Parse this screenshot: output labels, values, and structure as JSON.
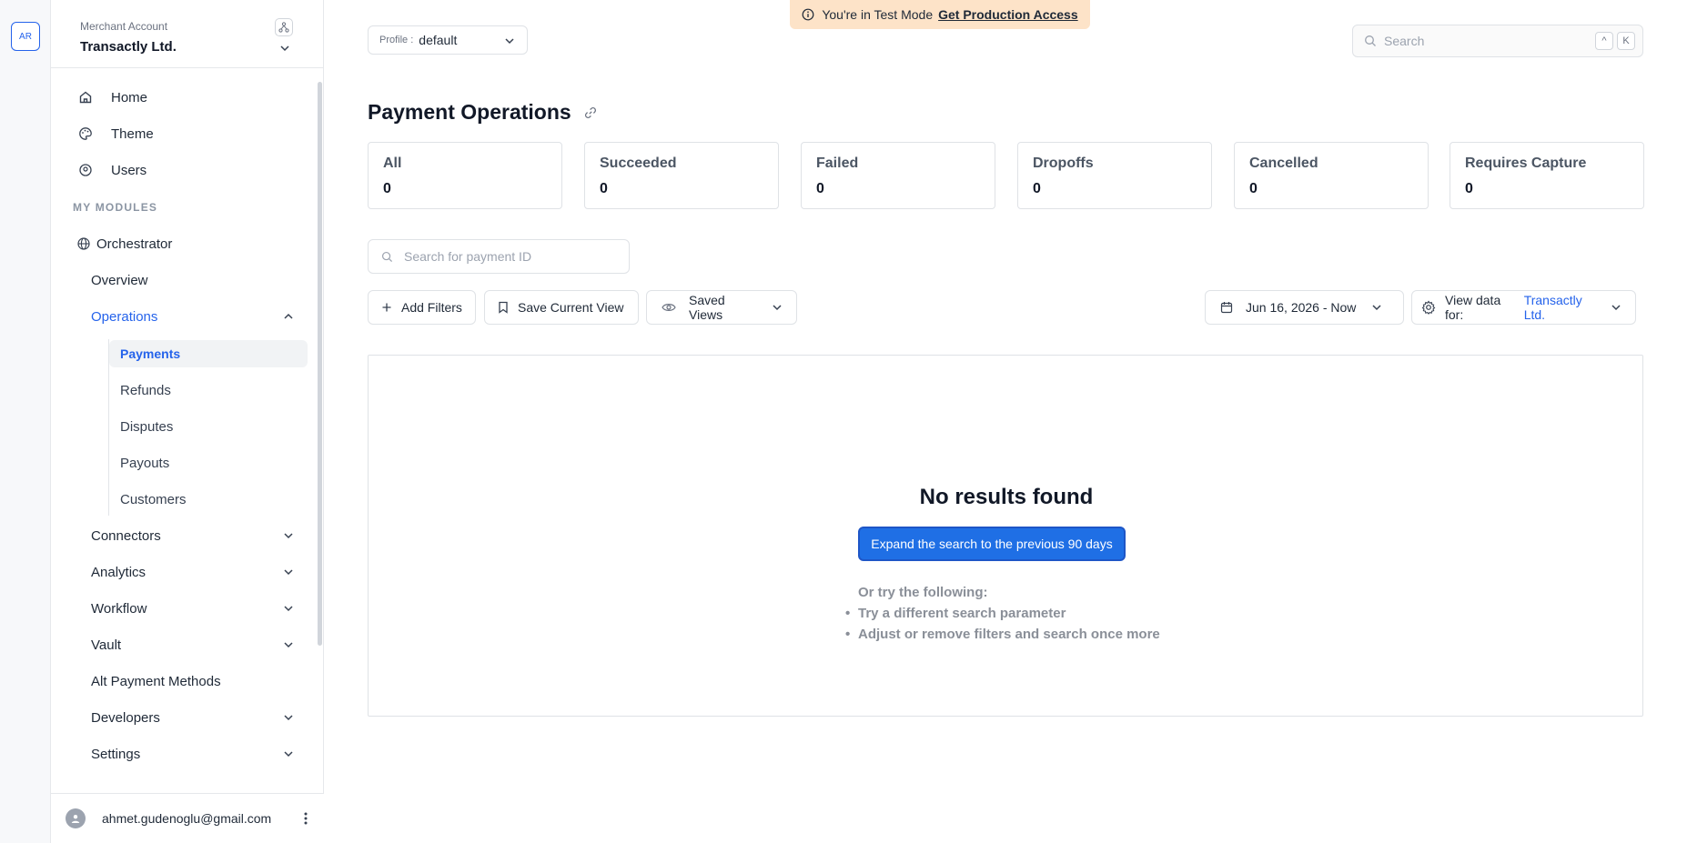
{
  "rail": {
    "avatar": "AR"
  },
  "merchant": {
    "label": "Merchant Account",
    "name": "Transactly Ltd."
  },
  "nav": {
    "top": [
      {
        "label": "Home",
        "icon": "home-icon"
      },
      {
        "label": "Theme",
        "icon": "palette-icon"
      },
      {
        "label": "Users",
        "icon": "users-icon"
      }
    ],
    "modules_label": "MY MODULES",
    "orchestrator": "Orchestrator",
    "overview": "Overview",
    "operations": "Operations",
    "operations_children": [
      "Payments",
      "Refunds",
      "Disputes",
      "Payouts",
      "Customers"
    ],
    "more": [
      "Connectors",
      "Analytics",
      "Workflow",
      "Vault"
    ],
    "alt_payment": "Alt Payment Methods",
    "developers": "Developers",
    "settings": "Settings"
  },
  "user": {
    "email": "ahmet.gudenoglu@gmail.com"
  },
  "banner": {
    "text": "You're in Test Mode",
    "link": "Get Production Access"
  },
  "profile": {
    "label": "Profile :",
    "value": "default"
  },
  "search": {
    "placeholder": "Search",
    "key1": "^",
    "key2": "K"
  },
  "page": {
    "title": "Payment Operations"
  },
  "stats": [
    {
      "label": "All",
      "value": "0"
    },
    {
      "label": "Succeeded",
      "value": "0"
    },
    {
      "label": "Failed",
      "value": "0"
    },
    {
      "label": "Dropoffs",
      "value": "0"
    },
    {
      "label": "Cancelled",
      "value": "0"
    },
    {
      "label": "Requires Capture",
      "value": "0"
    }
  ],
  "payment_search": {
    "placeholder": "Search for payment ID"
  },
  "toolbar": {
    "add_filters": "Add Filters",
    "save_view": "Save Current View",
    "saved_views": "Saved Views",
    "date_range": "Jun 16, 2026 - Now",
    "view_data_label": "View data for:",
    "view_data_value": "Transactly Ltd."
  },
  "results": {
    "title": "No results found",
    "expand_button": "Expand the search to the previous 90 days",
    "tips_head": "Or try the following:",
    "tips": [
      "Try a different search parameter",
      "Adjust or remove filters and search once more"
    ]
  },
  "colors": {
    "accent": "#2563eb",
    "banner": "#fde3c8",
    "primary_button": "#1f6fe5"
  }
}
